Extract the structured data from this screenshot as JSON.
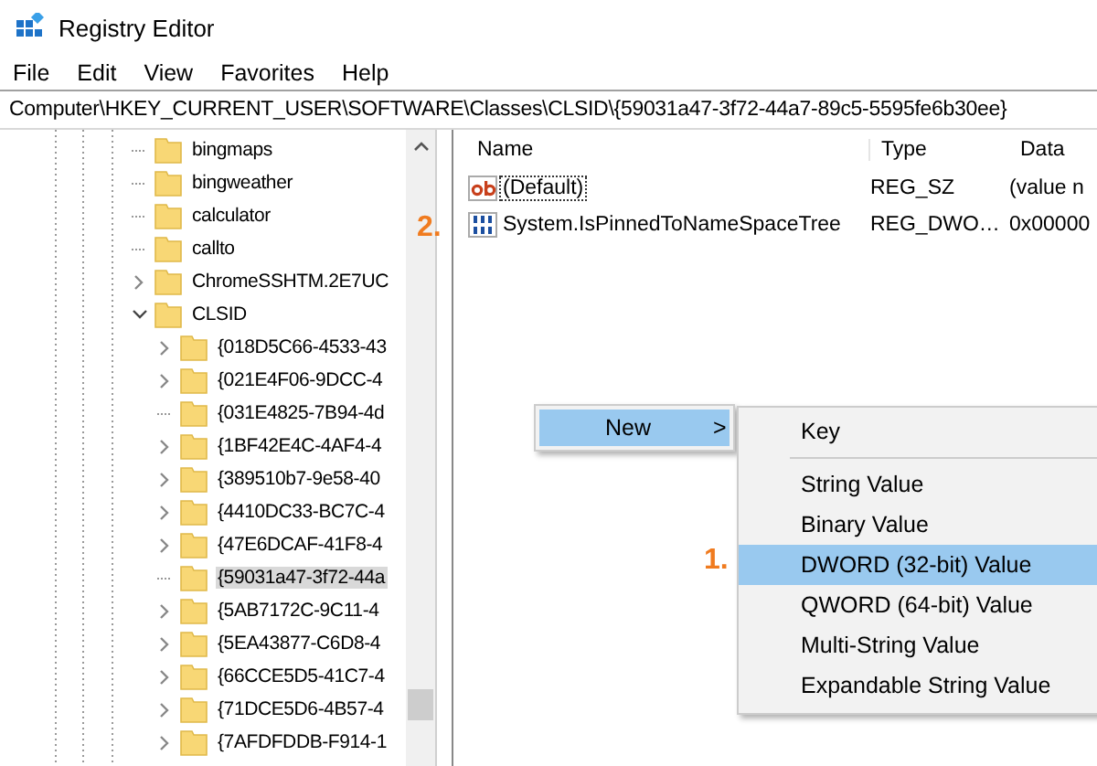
{
  "window": {
    "title": "Registry Editor"
  },
  "menu": [
    "File",
    "Edit",
    "View",
    "Favorites",
    "Help"
  ],
  "address": "Computer\\HKEY_CURRENT_USER\\SOFTWARE\\Classes\\CLSID\\{59031a47-3f72-44a7-89c5-5595fe6b30ee}",
  "tree": [
    {
      "label": "bingmaps",
      "kind": "leaf",
      "selected": false
    },
    {
      "label": "bingweather",
      "kind": "leaf",
      "selected": false
    },
    {
      "label": "calculator",
      "kind": "leaf",
      "selected": false
    },
    {
      "label": "callto",
      "kind": "leaf",
      "selected": false
    },
    {
      "label": "ChromeSSHTM.2E7UC",
      "kind": "collapsed",
      "selected": false
    },
    {
      "label": "CLSID",
      "kind": "expanded",
      "selected": false,
      "children": [
        {
          "label": "{018D5C66-4533-43",
          "kind": "collapsed",
          "selected": false
        },
        {
          "label": "{021E4F06-9DCC-4",
          "kind": "collapsed",
          "selected": false
        },
        {
          "label": "{031E4825-7B94-4d",
          "kind": "leaf",
          "selected": false
        },
        {
          "label": "{1BF42E4C-4AF4-4",
          "kind": "collapsed",
          "selected": false
        },
        {
          "label": "{389510b7-9e58-40",
          "kind": "collapsed",
          "selected": false
        },
        {
          "label": "{4410DC33-BC7C-4",
          "kind": "collapsed",
          "selected": false
        },
        {
          "label": "{47E6DCAF-41F8-4",
          "kind": "collapsed",
          "selected": false
        },
        {
          "label": "{59031a47-3f72-44a",
          "kind": "leaf",
          "selected": true
        },
        {
          "label": "{5AB7172C-9C11-4",
          "kind": "collapsed",
          "selected": false
        },
        {
          "label": "{5EA43877-C6D8-4",
          "kind": "collapsed",
          "selected": false
        },
        {
          "label": "{66CCE5D5-41C7-4",
          "kind": "collapsed",
          "selected": false
        },
        {
          "label": "{71DCE5D6-4B57-4",
          "kind": "collapsed",
          "selected": false
        },
        {
          "label": "{7AFDFDDB-F914-1",
          "kind": "collapsed",
          "selected": false
        }
      ]
    }
  ],
  "values": {
    "columns": [
      "Name",
      "Type",
      "Data"
    ],
    "rows": [
      {
        "name": "(Default)",
        "type": "REG_SZ",
        "data": "(value n",
        "kind": "string",
        "focused": true
      },
      {
        "name": "System.IsPinnedToNameSpaceTree",
        "type": "REG_DWO…",
        "data": "0x00000",
        "kind": "binary",
        "focused": false
      }
    ]
  },
  "context_menu": {
    "items": [
      {
        "label": "New",
        "selected": true,
        "arrow": ">"
      }
    ]
  },
  "submenu": {
    "items": [
      {
        "label": "Key",
        "selected": false,
        "separator_after": true
      },
      {
        "label": "String Value",
        "selected": false,
        "separator_after": false
      },
      {
        "label": "Binary Value",
        "selected": false,
        "separator_after": false
      },
      {
        "label": "DWORD (32-bit) Value",
        "selected": true,
        "separator_after": false
      },
      {
        "label": "QWORD (64-bit) Value",
        "selected": false,
        "separator_after": false
      },
      {
        "label": "Multi-String Value",
        "selected": false,
        "separator_after": false
      },
      {
        "label": "Expandable String Value",
        "selected": false,
        "separator_after": false
      }
    ]
  },
  "annotations": [
    "2.",
    "1."
  ]
}
